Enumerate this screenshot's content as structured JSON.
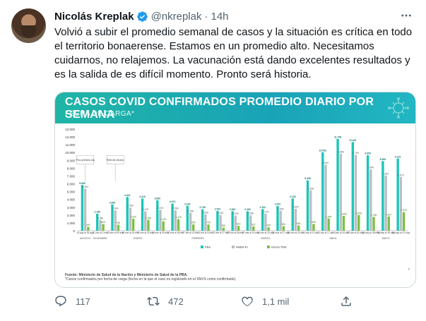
{
  "tweet": {
    "author_name": "Nicolás Kreplak",
    "handle": "@nkreplak",
    "separator": "·",
    "time": "14h",
    "text": "Volvió a subir el promedio semanal de casos y la situación es crítica en todo el territorio bonaerense. Estamos en un promedio alto. Necesitamos cuidarnos, no relajemos. La vacunación está dando excelentes resultados y es la salida de es difícil momento. Pronto será historia.",
    "replies": "117",
    "retweets": "472",
    "likes": "1,1 mil"
  },
  "icons": {
    "verified": "verified-badge-icon",
    "more": "more-options-icon",
    "reply": "reply-icon",
    "retweet": "retweet-icon",
    "like": "heart-icon",
    "share": "share-icon"
  },
  "colors": {
    "pba": "#1cc6b8",
    "amba": "#b9c0c6",
    "interior": "#7bc142",
    "banner": "#1fb5a6",
    "muted": "#536471"
  },
  "chart_data": {
    "type": "bar",
    "title": "CASOS COVID CONFIRMADOS PROMEDIO DIARIO POR SEMANA",
    "subtitle": "FECHA DE CARGA*",
    "ylim": [
      0,
      13000
    ],
    "yticks": [
      "13.000",
      "12.000",
      "11.000",
      "10.000",
      "9.000",
      "8.000",
      "7.000",
      "6.000",
      "5.000",
      "4.000",
      "3.000",
      "2.000",
      "1.000",
      "0"
    ],
    "categories": [
      "24-ago al 30-ago",
      "31-dic al 2-ene",
      "03-ene al 09-ene",
      "10-ene al 16-ene",
      "17-ene al 23-ene",
      "24-ene al 30-ene",
      "31-ene al 06-feb",
      "07-feb al 13-feb",
      "14-feb al 20-feb",
      "21-feb al 27-feb",
      "28-feb al 06-mar",
      "07-mar al 13-mar",
      "14-mar al 20-mar",
      "21-mar al 27-mar",
      "28-mar al 03-abr",
      "04-abr al 10-abr",
      "11-abr al 17-abr",
      "18-abr al 24-abr",
      "25-abr al 01-may",
      "02-may al 08-may",
      "09-may al 15-may",
      "16-may al 22-may"
    ],
    "months": [
      {
        "label": "AGOSTO",
        "from": 0,
        "to": 0
      },
      {
        "label": "DICIEMBRE",
        "from": 1,
        "to": 1
      },
      {
        "label": "ENERO",
        "from": 2,
        "to": 5
      },
      {
        "label": "FEBRERO",
        "from": 6,
        "to": 9
      },
      {
        "label": "MARZO",
        "from": 10,
        "to": 14
      },
      {
        "label": "ABRIL",
        "from": 15,
        "to": 18
      },
      {
        "label": "MAYO",
        "from": 19,
        "to": 21
      }
    ],
    "series": [
      {
        "name": "PBA",
        "values": [
          5845,
          2165,
          3359,
          4310,
          4115,
          3892,
          3474,
          3182,
          2739,
          2522,
          2502,
          2493,
          2763,
          3152,
          4125,
          6435,
          10032,
          11748,
          11341,
          9653,
          8905,
          9221
        ]
      },
      {
        "name": "AMBA 40",
        "values": [
          5394,
          1356,
          2604,
          2969,
          2478,
          2674,
          2599,
          2268,
          2090,
          2020,
          1929,
          1968,
          2178,
          2535,
          2803,
          5168,
          8442,
          9858,
          9705,
          7849,
          7061,
          6870
        ]
      },
      {
        "name": "Interior PBA",
        "values": [
          490,
          843,
          766,
          1529,
          1369,
          1200,
          1478,
          805,
          795,
          399,
          619,
          537,
          435,
          584,
          664,
          848,
          1554,
          1883,
          2008,
          1766,
          1817,
          2376
        ]
      }
    ],
    "annotations": [
      {
        "text": "Pico primera ola",
        "category_index": 0
      },
      {
        "text": "Rebrote verano",
        "category_index": 2
      }
    ],
    "legend": {
      "placement": "bottom-center",
      "items": [
        "PBA",
        "AMBA 40",
        "Interior PBA"
      ]
    },
    "source": "Fuente: Ministerio de Salud de la Nación y Ministerio de Salud de la PBA.",
    "footnote": "*Casos confirmados por fecha de carga (fecha en la que el caso es registrado en el SNVS como confirmado).",
    "page_number": "7",
    "grid": false
  }
}
